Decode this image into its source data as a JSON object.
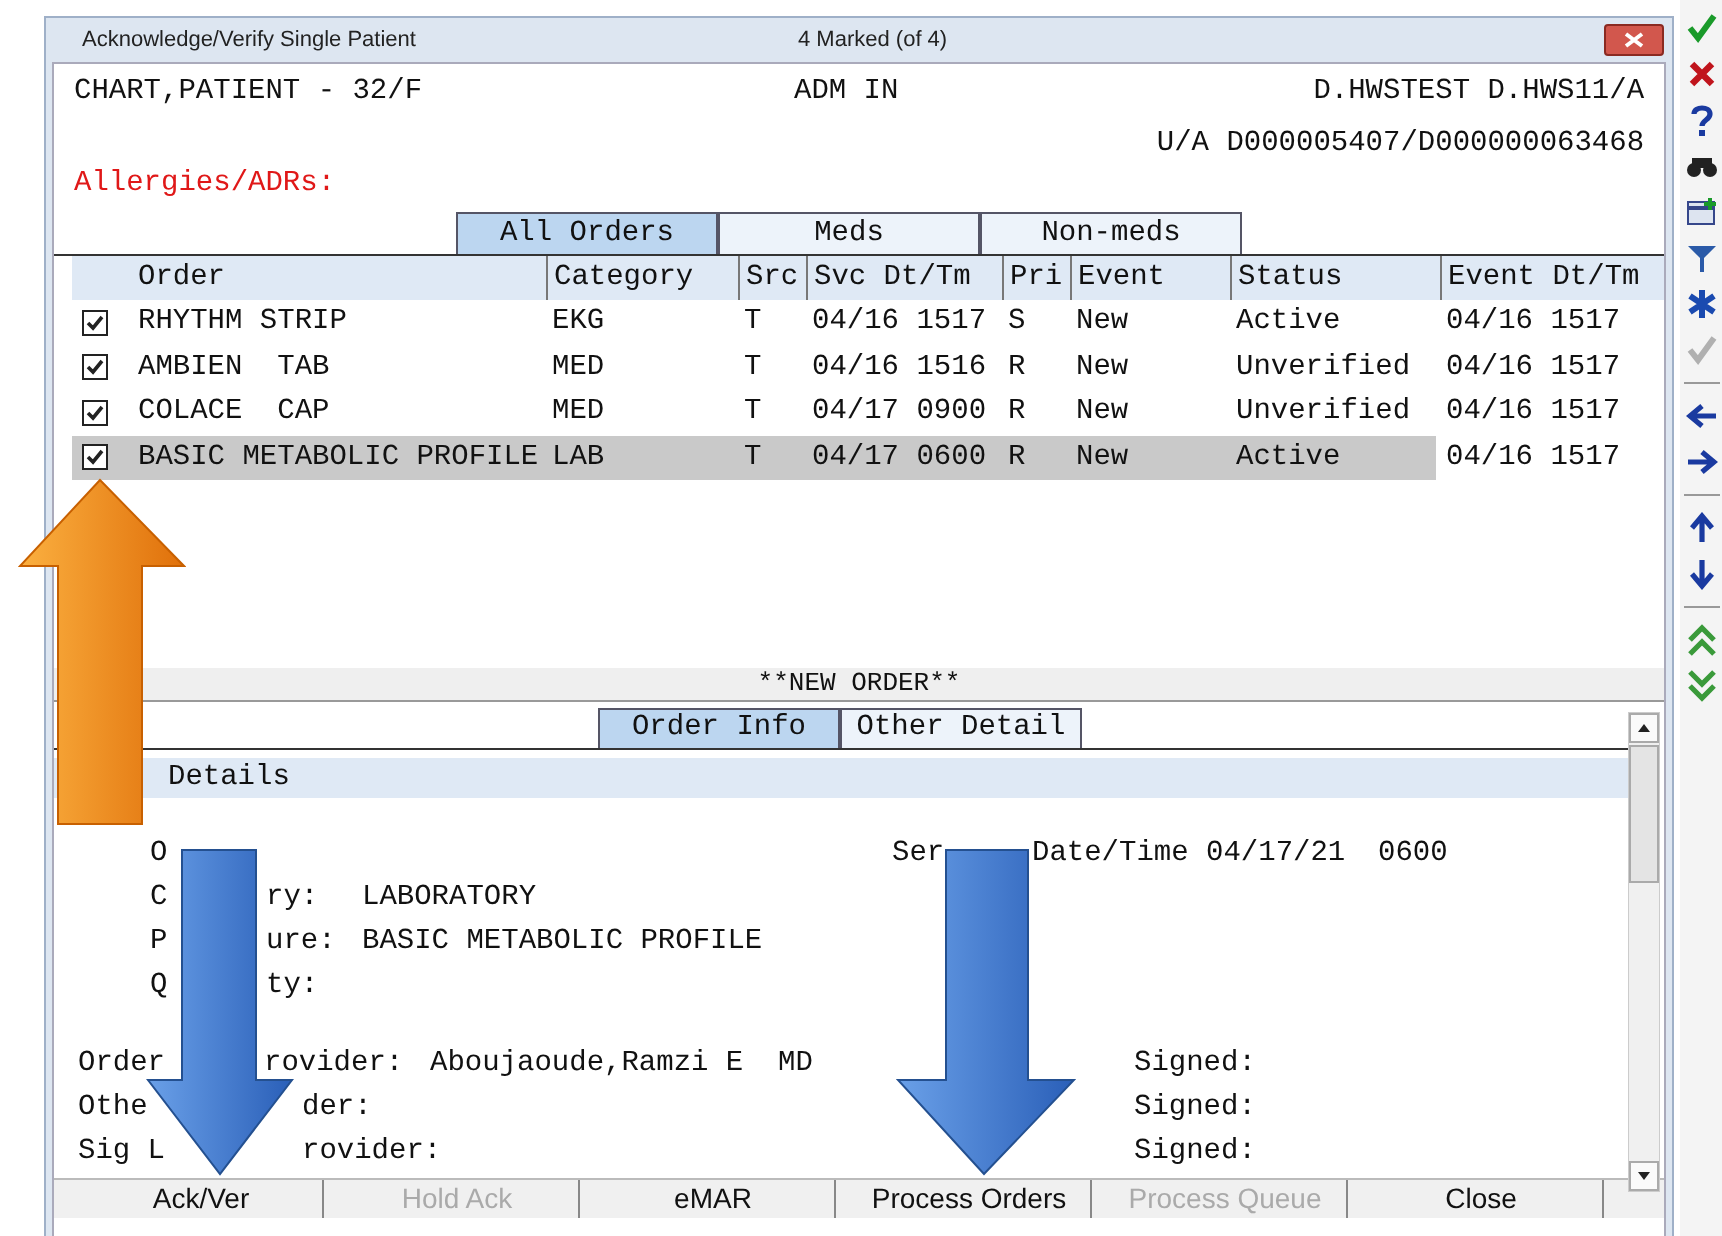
{
  "window": {
    "title": "Acknowledge/Verify Single Patient",
    "marked": "4 Marked  (of 4)"
  },
  "patient": {
    "name": "CHART,PATIENT - 32/F",
    "status": "ADM IN",
    "location": "D.HWSTEST D.HWS11/A",
    "account": "U/A D000005407/D000000063468",
    "allergies": "Allergies/ADRs:"
  },
  "tabs": [
    {
      "label": "All Orders",
      "selected": true
    },
    {
      "label": "Meds",
      "selected": false
    },
    {
      "label": "Non-meds",
      "selected": false
    }
  ],
  "table": {
    "columns": [
      "Order",
      "Category",
      "Src",
      "Svc Dt/Tm",
      "Pri",
      "Event",
      "Status",
      "Event Dt/Tm"
    ],
    "rows": [
      {
        "checked": true,
        "selected": false,
        "cells": [
          "RHYTHM STRIP",
          "EKG",
          "T",
          "04/16 1517",
          "S",
          "New",
          "Active",
          "04/16 1517"
        ]
      },
      {
        "checked": true,
        "selected": false,
        "cells": [
          "AMBIEN  TAB",
          "MED",
          "T",
          "04/16 1516",
          "R",
          "New",
          "Unverified",
          "04/16 1517"
        ]
      },
      {
        "checked": true,
        "selected": false,
        "cells": [
          "COLACE  CAP",
          "MED",
          "T",
          "04/17 0900",
          "R",
          "New",
          "Unverified",
          "04/16 1517"
        ]
      },
      {
        "checked": true,
        "selected": true,
        "cells": [
          "BASIC METABOLIC PROFILE",
          "LAB",
          "T",
          "04/17 0600",
          "R",
          "New",
          "Active",
          "04/16 1517"
        ]
      }
    ]
  },
  "new_order_label": "**NEW ORDER**",
  "detail_tabs": [
    {
      "label": "Order Info",
      "selected": true
    },
    {
      "label": "Other Detail",
      "selected": false
    }
  ],
  "details": {
    "section": "Details",
    "lines": [
      {
        "kind": "top",
        "left": "O",
        "side": [
          "Ser",
          "Date/Time 04/17/21",
          "0600"
        ]
      },
      {
        "kind": "top",
        "left": "C",
        "right": "ry:",
        "value": "LABORATORY"
      },
      {
        "kind": "top",
        "left": "P",
        "right": "ure:",
        "value": "BASIC METABOLIC PROFILE"
      },
      {
        "kind": "top",
        "left": "Q",
        "right": "ty:"
      },
      {
        "kind": "provider",
        "left": "Order",
        "right": "rovider:",
        "value": "Aboujaoude,Ramzi E  MD",
        "signed": "Signed:"
      },
      {
        "kind": "provider",
        "left": "Othe",
        "right": "der:",
        "signed": "Signed:"
      },
      {
        "kind": "provider",
        "left": "Sig L",
        "right": "rovider:",
        "signed": "Signed:"
      }
    ]
  },
  "buttons": [
    {
      "label": "Ack/Ver",
      "disabled": false
    },
    {
      "label": "Hold Ack",
      "disabled": true
    },
    {
      "label": "eMAR",
      "disabled": false
    },
    {
      "label": "Process Orders",
      "disabled": false
    },
    {
      "label": "Process Queue",
      "disabled": true
    },
    {
      "label": "Close",
      "disabled": false
    }
  ]
}
